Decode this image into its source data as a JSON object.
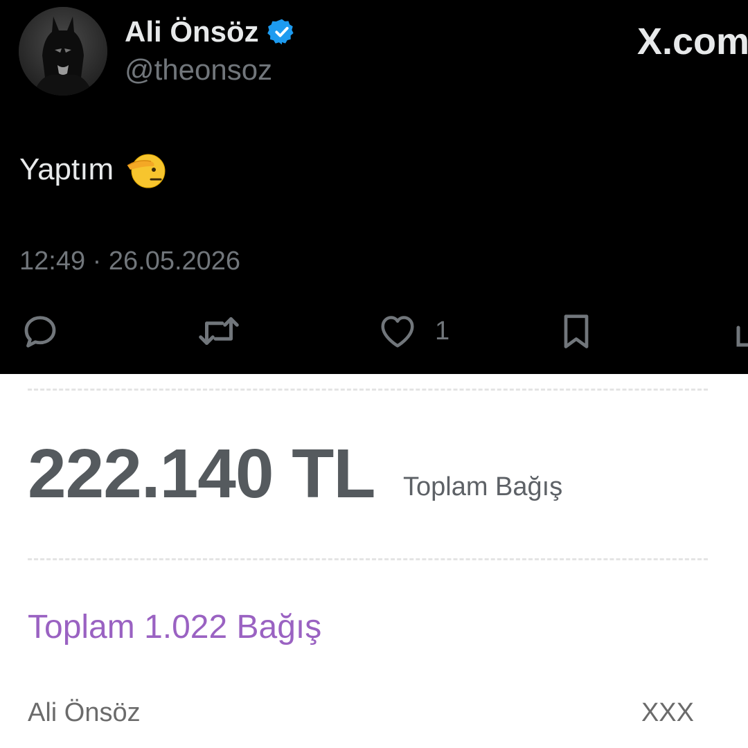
{
  "tweet": {
    "display_name": "Ali Önsöz",
    "handle": "@theonsoz",
    "site_logo": "X.com",
    "text": "Yaptım",
    "emoji": "saluting-face",
    "timestamp": "12:49 · 26.05.2026",
    "actions": {
      "reply_icon": "reply-icon",
      "retweet_icon": "retweet-icon",
      "like_icon": "heart-icon",
      "like_count": "1",
      "bookmark_icon": "bookmark-icon",
      "share_icon": "share-icon"
    },
    "colors": {
      "background": "#000000",
      "text": "#e7e9ea",
      "muted": "#71767b",
      "verified": "#1d9bf0"
    }
  },
  "donation": {
    "amount": "222.140 TL",
    "amount_label": "Toplam Bağış",
    "count_text": "Toplam 1.022 Bağış",
    "donors": [
      {
        "name": "Ali Önsöz",
        "amount": "XXX"
      }
    ],
    "colors": {
      "amount": "#555a5e",
      "accent": "#9a62c2"
    }
  }
}
